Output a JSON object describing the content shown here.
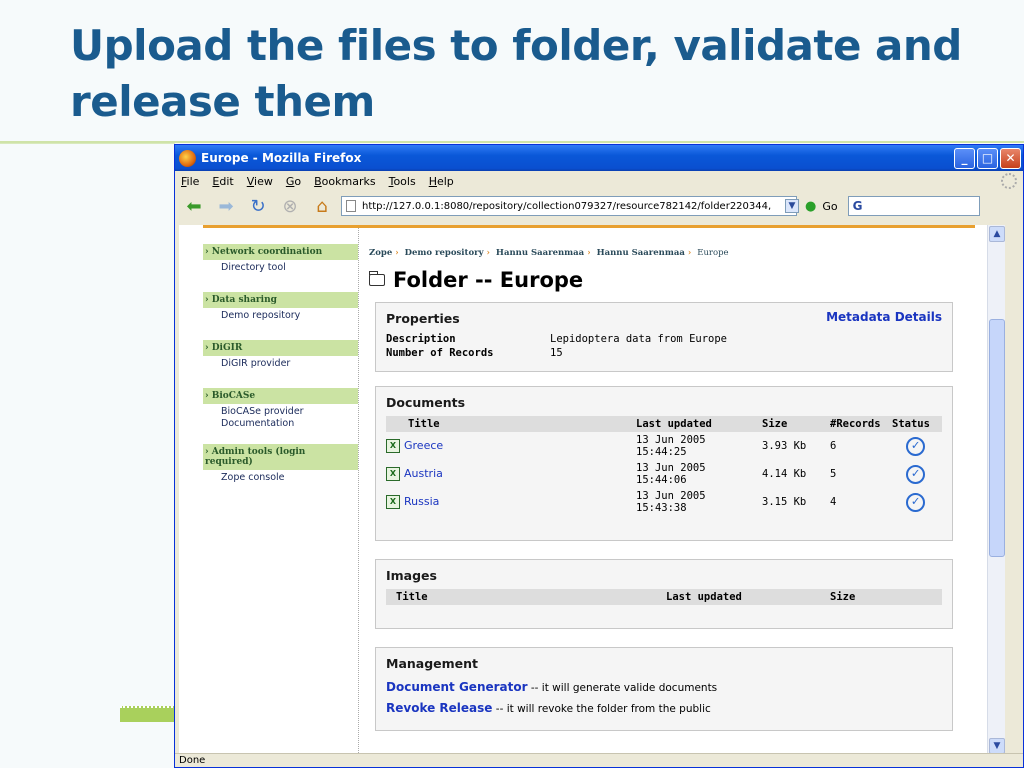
{
  "slide": {
    "title": "Upload the files to folder, validate and release them"
  },
  "browser": {
    "window_title": "Europe - Mozilla Firefox",
    "menu": [
      "File",
      "Edit",
      "View",
      "Go",
      "Bookmarks",
      "Tools",
      "Help"
    ],
    "url": "http://127.0.0.1:8080/repository/collection079327/resource782142/folder220344,",
    "go_label": "Go",
    "search_text": "G",
    "status": "Done"
  },
  "sidebar": {
    "sections": [
      {
        "heading": "Network coordination",
        "links": [
          "Directory tool"
        ]
      },
      {
        "heading": "Data sharing",
        "links": [
          "Demo repository"
        ]
      },
      {
        "heading": "DiGIR",
        "links": [
          "DiGIR provider"
        ]
      },
      {
        "heading": "BioCASe",
        "links": [
          "BioCASe provider",
          "Documentation"
        ]
      },
      {
        "heading": "Admin tools (login required)",
        "links": [
          "Zope console"
        ]
      }
    ]
  },
  "breadcrumb": [
    "Zope",
    "Demo repository",
    "Hannu Saarenmaa",
    "Hannu Saarenmaa",
    "Europe"
  ],
  "folder_title": "Folder -- Europe",
  "properties": {
    "heading": "Properties",
    "metadata_link": "Metadata Details",
    "description_label": "Description",
    "description_value": "Lepidoptera data from Europe",
    "records_label": "Number of Records",
    "records_value": "15"
  },
  "documents": {
    "heading": "Documents",
    "columns": [
      "Title",
      "Last updated",
      "Size",
      "#Records",
      "Status"
    ],
    "rows": [
      {
        "title": "Greece",
        "date": "13 Jun 2005",
        "time": "15:44:25",
        "size": "3.93 Kb",
        "records": "6"
      },
      {
        "title": "Austria",
        "date": "13 Jun 2005",
        "time": "15:44:06",
        "size": "4.14 Kb",
        "records": "5"
      },
      {
        "title": "Russia",
        "date": "13 Jun 2005",
        "time": "15:43:38",
        "size": "3.15 Kb",
        "records": "4"
      }
    ]
  },
  "images": {
    "heading": "Images",
    "columns": [
      "Title",
      "Last updated",
      "Size"
    ]
  },
  "management": {
    "heading": "Management",
    "items": [
      {
        "link": "Document Generator",
        "text": "-- it will generate valide documents"
      },
      {
        "link": "Revoke Release",
        "text": "-- it will revoke the folder from the public"
      }
    ]
  }
}
